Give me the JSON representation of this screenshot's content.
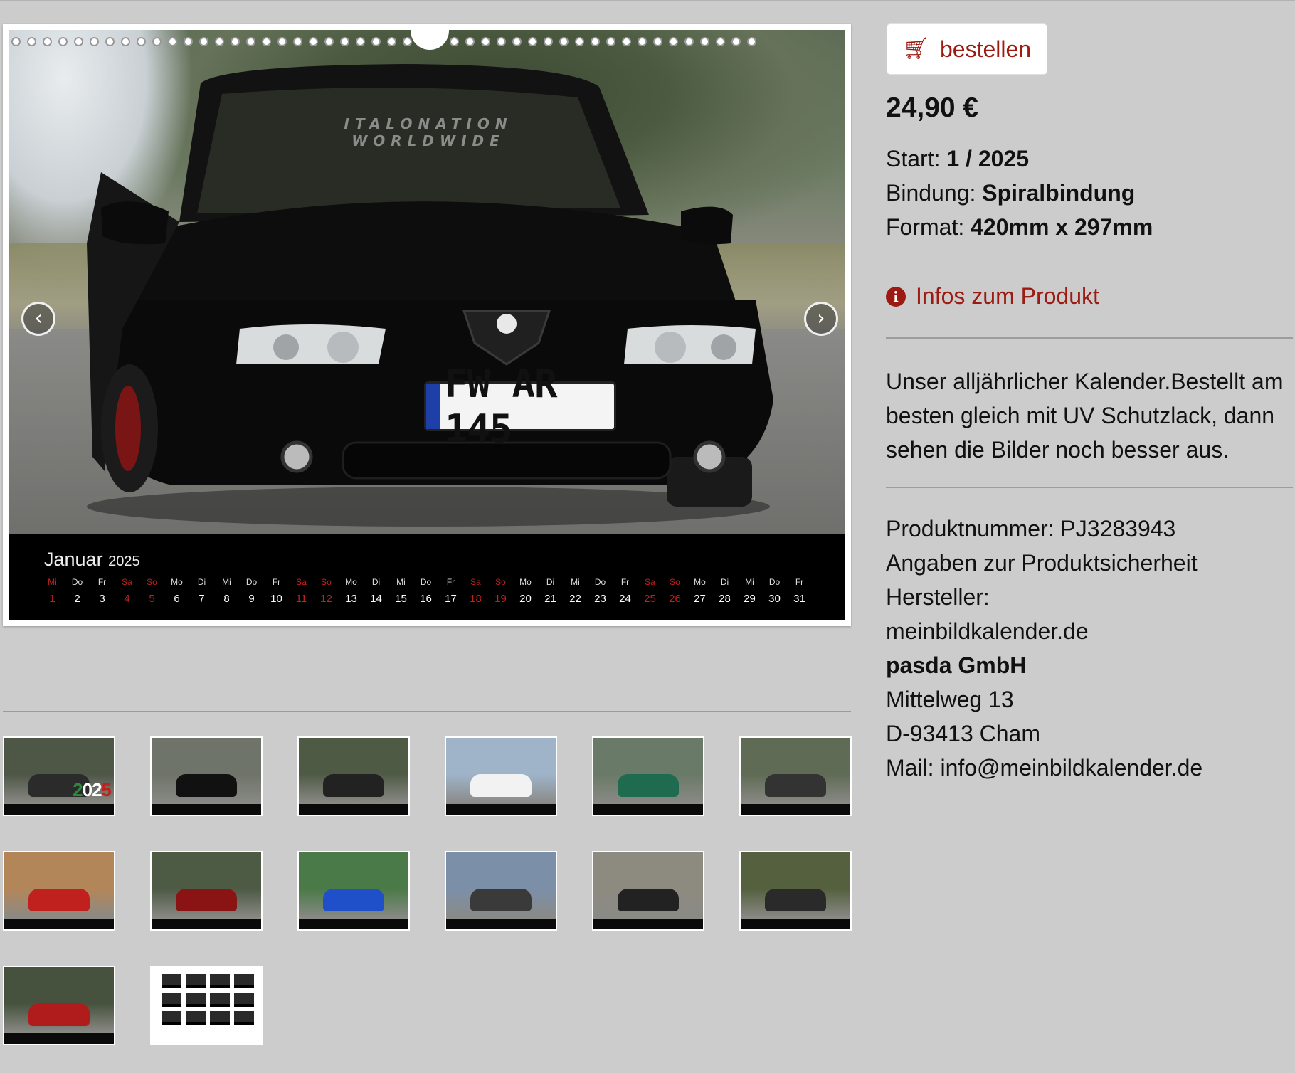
{
  "main_preview": {
    "windshield_banner": "ITALONATION WORLDWIDE",
    "license_plate": "FW AR 145",
    "month": "Januar",
    "year": "2025",
    "days": [
      {
        "wd": "Mi",
        "d": "1",
        "we": true
      },
      {
        "wd": "Do",
        "d": "2"
      },
      {
        "wd": "Fr",
        "d": "3"
      },
      {
        "wd": "Sa",
        "d": "4",
        "we": true
      },
      {
        "wd": "So",
        "d": "5",
        "we": true
      },
      {
        "wd": "Mo",
        "d": "6"
      },
      {
        "wd": "Di",
        "d": "7"
      },
      {
        "wd": "Mi",
        "d": "8"
      },
      {
        "wd": "Do",
        "d": "9"
      },
      {
        "wd": "Fr",
        "d": "10"
      },
      {
        "wd": "Sa",
        "d": "11",
        "we": true
      },
      {
        "wd": "So",
        "d": "12",
        "we": true
      },
      {
        "wd": "Mo",
        "d": "13"
      },
      {
        "wd": "Di",
        "d": "14"
      },
      {
        "wd": "Mi",
        "d": "15"
      },
      {
        "wd": "Do",
        "d": "16"
      },
      {
        "wd": "Fr",
        "d": "17"
      },
      {
        "wd": "Sa",
        "d": "18",
        "we": true
      },
      {
        "wd": "So",
        "d": "19",
        "we": true
      },
      {
        "wd": "Mo",
        "d": "20"
      },
      {
        "wd": "Di",
        "d": "21"
      },
      {
        "wd": "Mi",
        "d": "22"
      },
      {
        "wd": "Do",
        "d": "23"
      },
      {
        "wd": "Fr",
        "d": "24"
      },
      {
        "wd": "Sa",
        "d": "25",
        "we": true
      },
      {
        "wd": "So",
        "d": "26",
        "we": true
      },
      {
        "wd": "Mo",
        "d": "27"
      },
      {
        "wd": "Di",
        "d": "28"
      },
      {
        "wd": "Mi",
        "d": "29"
      },
      {
        "wd": "Do",
        "d": "30"
      },
      {
        "wd": "Fr",
        "d": "31"
      }
    ],
    "prev_icon": "chevron-left-icon",
    "next_icon": "chevron-right-icon"
  },
  "thumbnails": [
    {
      "name": "cover",
      "theme": "cover",
      "year_logo": "2025",
      "photo": "#4e5646",
      "car": "#2b2b2b"
    },
    {
      "name": "januar",
      "photo": "#6e746a",
      "car": "#111111"
    },
    {
      "name": "februar",
      "photo": "#4f5a45",
      "car": "#222222"
    },
    {
      "name": "maerz",
      "photo": "#9fb3c9",
      "car": "#f2f2f2"
    },
    {
      "name": "april",
      "photo": "#6a7a68",
      "car": "#1f6b4f"
    },
    {
      "name": "mai",
      "photo": "#5f6b55",
      "car": "#333333"
    },
    {
      "name": "juni",
      "photo": "#b3865a",
      "car": "#c0201e"
    },
    {
      "name": "juli",
      "photo": "#4d5a44",
      "car": "#8a1414"
    },
    {
      "name": "august",
      "photo": "#4a7a48",
      "car": "#1f4fc9"
    },
    {
      "name": "september",
      "photo": "#7c8fa8",
      "car": "#3a3a3a"
    },
    {
      "name": "oktober",
      "photo": "#8d8a80",
      "car": "#222222"
    },
    {
      "name": "november",
      "photo": "#55603f",
      "car": "#2a2a2a"
    },
    {
      "name": "dezember",
      "photo": "#46523d",
      "car": "#b01c1c"
    },
    {
      "name": "overview",
      "theme": "overview"
    }
  ],
  "order": {
    "button_label": "bestellen",
    "cart_icon": "shopping-cart-icon",
    "price": "24,90 €",
    "start_label": "Start:",
    "start_value": "1 / 2025",
    "binding_label": "Bindung:",
    "binding_value": "Spiralbindung",
    "format_label": "Format:",
    "format_value": "420mm x 297mm",
    "info_link": "Infos zum Produkt",
    "info_icon": "info-circle-icon",
    "accent_color": "#9b1a12"
  },
  "description": "Unser alljährlicher Kalender.Bestellt am besten gleich mit UV Schutzlack, dann sehen die Bilder noch besser aus.",
  "meta": {
    "product_number": "Produktnummer: PJ3283943",
    "safety_heading": "Angaben zur Produktsicherheit",
    "manufacturer_label": "Hersteller:",
    "manufacturer_site": "meinbildkalender.de",
    "company": "pasda GmbH",
    "street": "Mittelweg 13",
    "city": "D-93413 Cham",
    "mail": "Mail: info@meinbildkalender.de"
  }
}
